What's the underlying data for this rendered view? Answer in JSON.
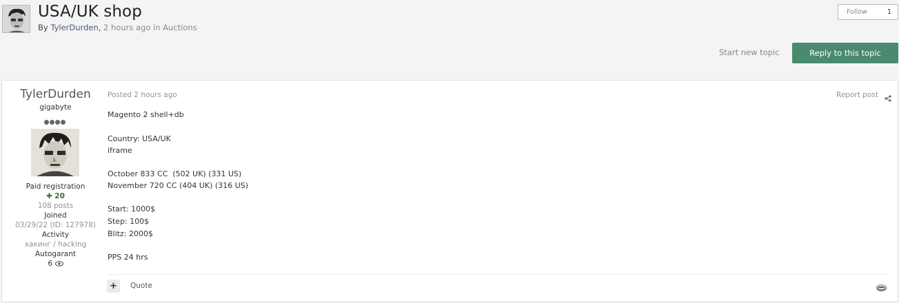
{
  "topic": {
    "title": "USA/UK shop",
    "by_label": "By ",
    "author": "TylerDurden",
    "separator": ",",
    "time": "2 hours ago",
    "in_label": "in",
    "forum": "Auctions"
  },
  "follow": {
    "label": "Follow",
    "count": "1"
  },
  "actions": {
    "start_new_topic": "Start new topic",
    "reply": "Reply to this topic"
  },
  "post": {
    "author": {
      "name": "TylerDurden",
      "rank": "gigabyte",
      "group": "Paid registration",
      "reputation": "20",
      "posts": "108 posts",
      "joined_label": "Joined",
      "joined_value": "03/29/22 (ID: 127978)",
      "activity_label": "Activity",
      "activity_value": "хакинг / hacking",
      "autogarant_label": "Autogarant",
      "autogarant_value": "6"
    },
    "posted": "Posted 2 hours ago",
    "report": "Report post",
    "lines": [
      "Magento 2 shell+db",
      "Country: USA/UK",
      "iframe",
      "October 833 CC  (502 UK) (331 US)",
      "November 720 CC (404 UK) (316 US)",
      "Start: 1000$",
      "Step: 100$",
      "Blitz: 2000$",
      "PPS 24 hrs"
    ],
    "plus": "+",
    "quote": "Quote"
  },
  "colors": {
    "accent": "#4a8a6e",
    "link": "#4b5d70",
    "muted": "#8c959e",
    "reputation": "#3b6d2a"
  },
  "icons": [
    "avatar",
    "share-icon",
    "plus-icon",
    "reaction-icon",
    "rank-dots-icon",
    "reputation-plus-icon",
    "eye-icon"
  ]
}
